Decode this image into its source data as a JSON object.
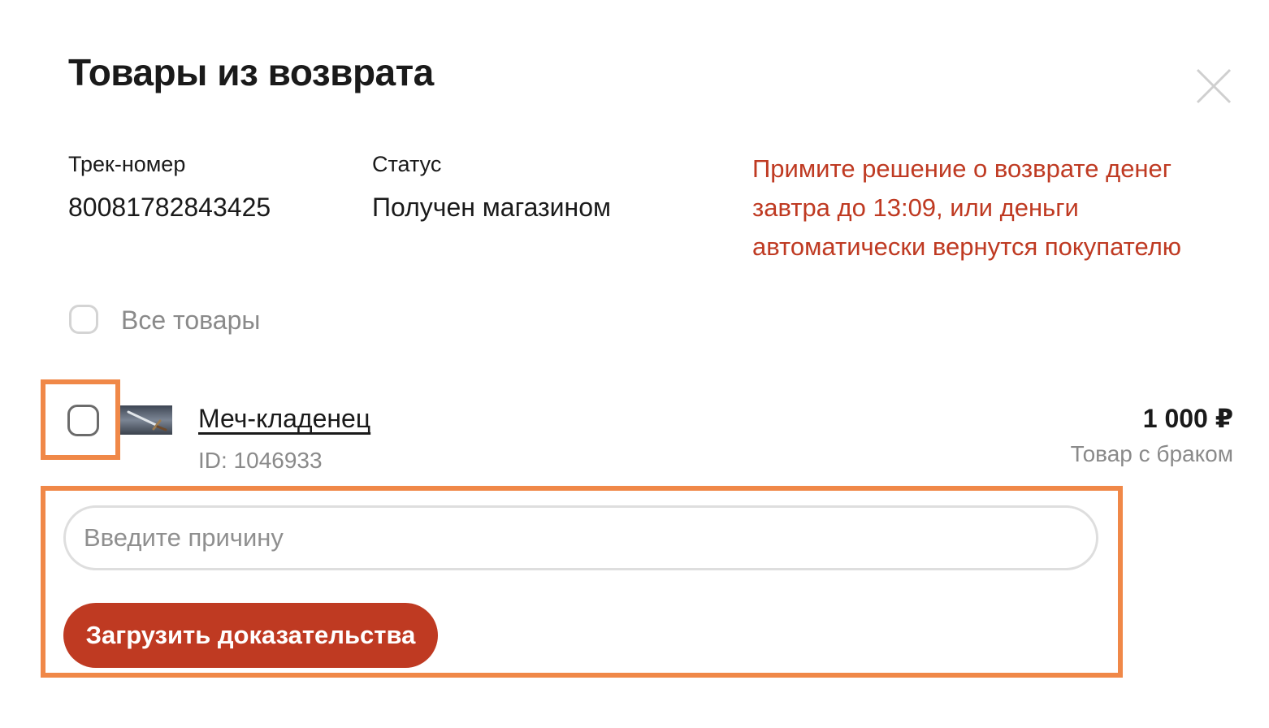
{
  "modal": {
    "title": "Товары из возврата",
    "close_icon": "close-icon"
  },
  "info": {
    "track_label": "Трек-номер",
    "track_value": "80081782843425",
    "status_label": "Статус",
    "status_value": "Получен магазином",
    "notice": "Примите решение о возврате денег завтра до 13:09, или деньги автоматически вернутся покупателю",
    "notice_color": "#bf3a22"
  },
  "select_all": {
    "label": "Все товары",
    "checked": false
  },
  "product": {
    "name": "Меч-кладенец",
    "id_text": "ID: 1046933",
    "price": "1 000 ₽",
    "condition": "Товар с браком",
    "checked": false,
    "thumbnail_icon": "sword-image"
  },
  "reason": {
    "placeholder": "Введите причину",
    "value": ""
  },
  "actions": {
    "upload_label": "Загрузить доказательства",
    "upload_color": "#bf3a22"
  },
  "highlight_color": "#f08848"
}
